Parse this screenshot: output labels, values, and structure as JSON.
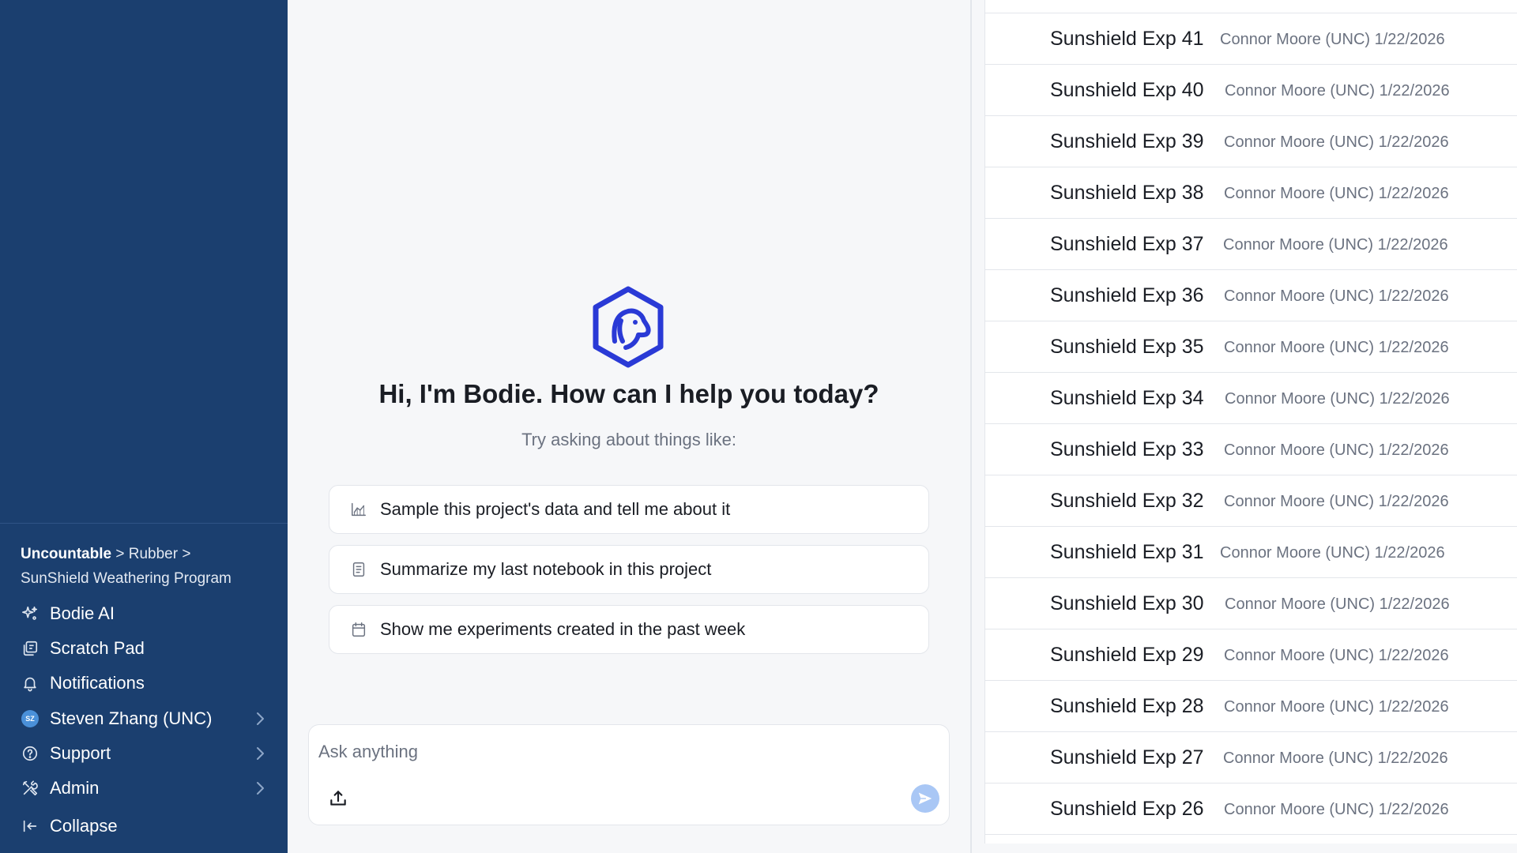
{
  "sidebar": {
    "breadcrumb": {
      "root": "Uncountable",
      "sep1": " > ",
      "level1": "Rubber",
      "sep2": " >",
      "project": "SunShield Weathering Program"
    },
    "nav": [
      {
        "label": "Bodie AI",
        "icon": "sparkle-icon"
      },
      {
        "label": "Scratch Pad",
        "icon": "notepad-icon"
      },
      {
        "label": "Notifications",
        "icon": "bell-icon"
      },
      {
        "label": "Steven Zhang (UNC)",
        "icon": "avatar",
        "avatar_initials": "SZ",
        "has_chevron": true
      },
      {
        "label": "Support",
        "icon": "help-circle-icon",
        "has_chevron": true
      },
      {
        "label": "Admin",
        "icon": "tools-icon",
        "has_chevron": true
      },
      {
        "label": "Collapse",
        "icon": "collapse-left-icon"
      }
    ]
  },
  "chat": {
    "greeting": "Hi, I'm Bodie. How can I help you today?",
    "subtitle": "Try asking about things like:",
    "suggestions": [
      {
        "label": "Sample this project's data and tell me about it",
        "icon": "chart-icon"
      },
      {
        "label": "Summarize my last notebook in this project",
        "icon": "notebook-icon"
      },
      {
        "label": "Show me experiments created in the past week",
        "icon": "calendar-icon"
      }
    ],
    "input": {
      "placeholder": "Ask anything",
      "value": ""
    }
  },
  "experiments": {
    "rows": [
      {
        "name": "Sunshield Exp 41",
        "meta": "Connor Moore (UNC) 1/22/2026"
      },
      {
        "name": "Sunshield Exp 40",
        "meta": "Connor Moore (UNC) 1/22/2026"
      },
      {
        "name": "Sunshield Exp 39",
        "meta": "Connor Moore (UNC) 1/22/2026"
      },
      {
        "name": "Sunshield Exp 38",
        "meta": "Connor Moore (UNC) 1/22/2026"
      },
      {
        "name": "Sunshield Exp 37",
        "meta": "Connor Moore (UNC) 1/22/2026"
      },
      {
        "name": "Sunshield Exp 36",
        "meta": "Connor Moore (UNC) 1/22/2026"
      },
      {
        "name": "Sunshield Exp 35",
        "meta": "Connor Moore (UNC) 1/22/2026"
      },
      {
        "name": "Sunshield Exp 34",
        "meta": "Connor Moore (UNC) 1/22/2026"
      },
      {
        "name": "Sunshield Exp 33",
        "meta": "Connor Moore (UNC) 1/22/2026"
      },
      {
        "name": "Sunshield Exp 32",
        "meta": "Connor Moore (UNC) 1/22/2026"
      },
      {
        "name": "Sunshield Exp 31",
        "meta": "Connor Moore (UNC) 1/22/2026"
      },
      {
        "name": "Sunshield Exp 30",
        "meta": "Connor Moore (UNC) 1/22/2026"
      },
      {
        "name": "Sunshield Exp 29",
        "meta": "Connor Moore (UNC) 1/22/2026"
      },
      {
        "name": "Sunshield Exp 28",
        "meta": "Connor Moore (UNC) 1/22/2026"
      },
      {
        "name": "Sunshield Exp 27",
        "meta": "Connor Moore (UNC) 1/22/2026"
      },
      {
        "name": "Sunshield Exp 26",
        "meta": "Connor Moore (UNC) 1/22/2026"
      }
    ]
  },
  "colors": {
    "sidebar_bg": "#1b3f6f",
    "logo_blue": "#2a3ad6",
    "send_button": "#a9c7f5"
  }
}
